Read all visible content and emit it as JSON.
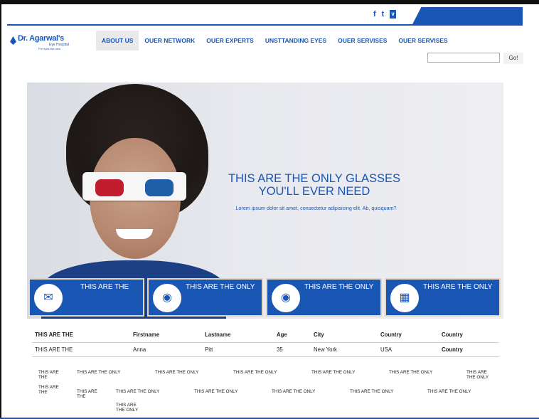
{
  "header": {
    "social": {
      "facebook": "f",
      "twitter": "t",
      "vimeo": "v"
    },
    "logo": {
      "name": "Dr. Agarwal's",
      "sub": "Eye Hospital",
      "tag": "For eyes like new"
    },
    "nav": [
      "ABOUT US",
      "OUER NETWORK",
      "OUER EXPERTS",
      "UNSTTANDING EYES",
      "OUER SERVISES",
      "OUER SERVISES"
    ],
    "search": {
      "placeholder": "",
      "button": "Go!"
    }
  },
  "hero": {
    "headline_line1": "THIS ARE THE ONLY GLASSES",
    "headline_line2": "YOU'LL EVER NEED",
    "text": "Lorem ipsum dolor sit amet, consectetur adipisicing elit. Ab, quisquam?"
  },
  "tiles": [
    {
      "label": "THIS ARE THE",
      "icon": "clipboard-icon"
    },
    {
      "label": "THIS ARE THE ONLY",
      "icon": "location-pin-icon"
    },
    {
      "label": "THIS ARE THE ONLY",
      "icon": "globe-icon"
    },
    {
      "label": "THIS ARE THE ONLY",
      "icon": "calendar-icon"
    }
  ],
  "table": {
    "headers": [
      "THIS ARE THE",
      "Firstname",
      "Lastname",
      "Age",
      "City",
      "Country",
      "Country"
    ],
    "row": [
      "THIS ARE THE",
      "Anna",
      "Pitt",
      "35",
      "New York",
      "USA",
      "Country"
    ]
  },
  "micro": {
    "a1": "THIS ARE THE",
    "a2": "THIS ARE THE ONLY",
    "a3": "THIS ARE THE ONLY",
    "a4": "THIS ARE THE ONLY",
    "a5": "THIS ARE THE ONLY",
    "a6": "THIS ARE THE ONLY",
    "a7": "THIS ARE THE ONLY",
    "b1": "THIS ARE THE",
    "b2": "THIS ARE THE",
    "b3": "THIS ARE THE ONLY",
    "b4": "THIS ARE THE ONLY",
    "b5": "THIS ARE THE ONLY",
    "b6": "THIS ARE THE ONLY",
    "b7": "THIS ARE THE ONLY",
    "c1": "THIS ARE THE ONLY"
  },
  "colors": {
    "brand": "#1a56b3",
    "tile_border": "#e3d7c3"
  }
}
